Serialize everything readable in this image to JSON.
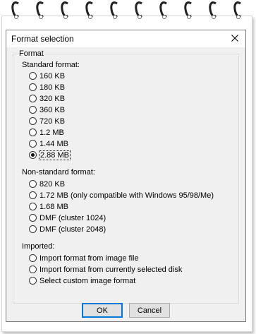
{
  "dialog": {
    "title": "Format selection",
    "close_icon": "close-icon"
  },
  "group": {
    "legend": "Format",
    "standard": {
      "label": "Standard format:",
      "options": [
        "160 KB",
        "180 KB",
        "320 KB",
        "360 KB",
        "720 KB",
        "1.2 MB",
        "1.44 MB",
        "2.88 MB"
      ],
      "selected": "2.88 MB"
    },
    "nonstandard": {
      "label": "Non-standard format:",
      "options": [
        "820 KB",
        "1.72 MB (only compatible with Windows 95/98/Me)",
        "1.68 MB",
        "DMF (cluster 1024)",
        "DMF (cluster 2048)"
      ]
    },
    "imported": {
      "label": "Imported:",
      "options": [
        "Import format from image file",
        "Import format from currently selected disk",
        "Select custom image format"
      ]
    }
  },
  "buttons": {
    "ok": "OK",
    "cancel": "Cancel"
  },
  "decor": {
    "spiral_ring_count": 10,
    "accent_color": "#0078d7"
  }
}
